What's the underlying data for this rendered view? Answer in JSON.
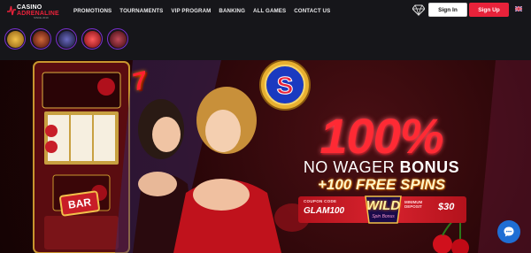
{
  "brand": {
    "name_line1": "CASINO",
    "name_line2": "ADRENALINE",
    "tagline": "SINCE 2019"
  },
  "nav": {
    "items": [
      {
        "label": "PROMOTIONS"
      },
      {
        "label": "TOURNAMENTS"
      },
      {
        "label": "VIP PROGRAM"
      },
      {
        "label": "BANKING"
      },
      {
        "label": "ALL GAMES"
      },
      {
        "label": "CONTACT US"
      }
    ]
  },
  "header": {
    "signin_label": "Sign In",
    "signup_label": "Sign Up",
    "vip_icon": "diamond-icon",
    "language_icon": "uk-flag-icon"
  },
  "stories": [
    {
      "name": "story-1",
      "color": "#c9861a"
    },
    {
      "name": "story-2",
      "color": "#8a1f1f"
    },
    {
      "name": "story-3",
      "color": "#2b2b55"
    },
    {
      "name": "story-4",
      "color": "#b0151f"
    },
    {
      "name": "story-5",
      "color": "#6a1a22"
    }
  ],
  "hero": {
    "percent": "100%",
    "no_wager_prefix": "NO WAGER ",
    "no_wager_bold": "BONUS",
    "free_spins": "+100 FREE SPINS",
    "coupon_label": "COUPON CODE",
    "coupon_code": "GLAM100",
    "wild_label": "WILD",
    "wild_sub": "Spin Bonus",
    "min_deposit_label_1": "MINIMUM",
    "min_deposit_label_2": "DEPOSIT",
    "min_deposit_value": "$30",
    "slot_bar_label": "BAR",
    "seven_symbol": "7",
    "coin_letter": "S"
  },
  "colors": {
    "accent": "#e8223a",
    "hero_red": "#ff2a34",
    "chat_blue": "#1f6ed4"
  }
}
